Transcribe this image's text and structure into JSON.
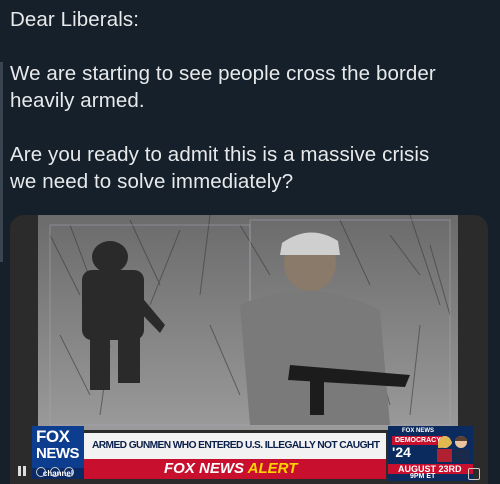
{
  "post": {
    "line1": "Dear Liberals:",
    "para1_l1": "We are starting to see people cross the border",
    "para1_l2": "heavily armed.",
    "para2_l1": "Are you ready to admit this is a massive crisis",
    "para2_l2": "we need to solve immediately?"
  },
  "media": {
    "ticker": {
      "logo_fox": "FOX",
      "logo_news": "NEWS",
      "logo_channel": "channel",
      "headline": "ARMED GUNMEN WHO ENTERED U.S. ILLEGALLY NOT CAUGHT",
      "network": "FOX NEWS",
      "alert": "ALERT"
    },
    "badge": {
      "network": "FOX NEWS",
      "program": "DEMOCRACY",
      "year": "'24",
      "date": "AUGUST 23RD",
      "time": "9PM ET"
    }
  }
}
